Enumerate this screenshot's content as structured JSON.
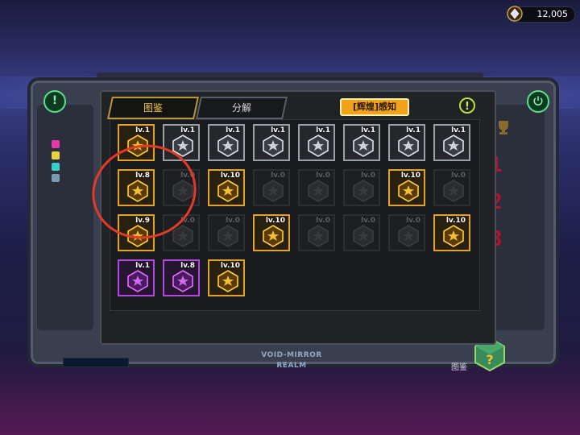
{
  "currency": {
    "amount": "12,005",
    "icon": "gem-coin-icon"
  },
  "tabs": [
    {
      "label": "图鉴",
      "active": true
    },
    {
      "label": "分解",
      "active": false
    }
  ],
  "filter_button": {
    "label": "[辉煌]感知"
  },
  "info_button": {
    "label": "!",
    "icon": "info-icon"
  },
  "side_buttons": {
    "left": "!",
    "right": "power-icon"
  },
  "ranks": [
    "1",
    "2",
    "3"
  ],
  "machine_label": {
    "line1": "VOID-MIRROR",
    "line2": "REALM"
  },
  "bottom_tab_label": "图鉴",
  "colors": {
    "gold": "#e2a32a",
    "silver": "#9aa0a8",
    "purple": "#b34ae0",
    "highlight_circle": "#e23a28",
    "filter_btn": "#f2a21a"
  },
  "grid": {
    "rows": [
      [
        {
          "level": "lv.1",
          "rarity": "gold",
          "icon": "heart-emblem-icon"
        },
        {
          "level": "lv.1",
          "rarity": "silver",
          "icon": "claw-emblem-icon"
        },
        {
          "level": "lv.1",
          "rarity": "silver",
          "icon": "lightning-fist-icon"
        },
        {
          "level": "lv.1",
          "rarity": "silver",
          "icon": "shield-crest-icon"
        },
        {
          "level": "lv.1",
          "rarity": "silver",
          "icon": "running-figure-icon"
        },
        {
          "level": "lv.1",
          "rarity": "silver",
          "icon": "star-burst-icon"
        },
        {
          "level": "lv.1",
          "rarity": "silver",
          "icon": "swirl-icon"
        },
        {
          "level": "lv.1",
          "rarity": "silver",
          "icon": "star-badge-icon"
        }
      ],
      [
        {
          "level": "lv.8",
          "rarity": "gold",
          "icon": "beast-face-icon"
        },
        {
          "level": "lv.0",
          "rarity": "locked",
          "icon": "flame-icon"
        },
        {
          "level": "lv.10",
          "rarity": "gold",
          "icon": "lightning-ring-icon"
        },
        {
          "level": "lv.0",
          "rarity": "locked",
          "icon": "hex-star-icon"
        },
        {
          "level": "lv.0",
          "rarity": "locked",
          "icon": "spider-icon"
        },
        {
          "level": "lv.0",
          "rarity": "locked",
          "icon": "spike-crown-icon"
        },
        {
          "level": "lv.10",
          "rarity": "gold",
          "icon": "fist-ring-icon"
        },
        {
          "level": "lv.0",
          "rarity": "locked",
          "icon": "mask-icon"
        }
      ],
      [
        {
          "level": "lv.9",
          "rarity": "gold",
          "icon": "bulb-icon"
        },
        {
          "level": "lv.0",
          "rarity": "locked",
          "icon": "cog-burst-icon"
        },
        {
          "level": "lv.0",
          "rarity": "locked",
          "icon": "flame-icon"
        },
        {
          "level": "lv.10",
          "rarity": "gold",
          "icon": "radiant-star-icon"
        },
        {
          "level": "lv.0",
          "rarity": "locked",
          "icon": "orb-icon"
        },
        {
          "level": "lv.0",
          "rarity": "locked",
          "icon": "ring-icon"
        },
        {
          "level": "lv.0",
          "rarity": "locked",
          "icon": "snowflake-icon"
        },
        {
          "level": "lv.10",
          "rarity": "gold",
          "icon": "fish-cross-icon"
        }
      ],
      [
        {
          "level": "lv.1",
          "rarity": "purple",
          "icon": "hex-crest-icon"
        },
        {
          "level": "lv.8",
          "rarity": "purple",
          "icon": "hex-crest-icon"
        },
        {
          "level": "lv.10",
          "rarity": "gold",
          "icon": "beast-crest-icon"
        }
      ]
    ]
  }
}
